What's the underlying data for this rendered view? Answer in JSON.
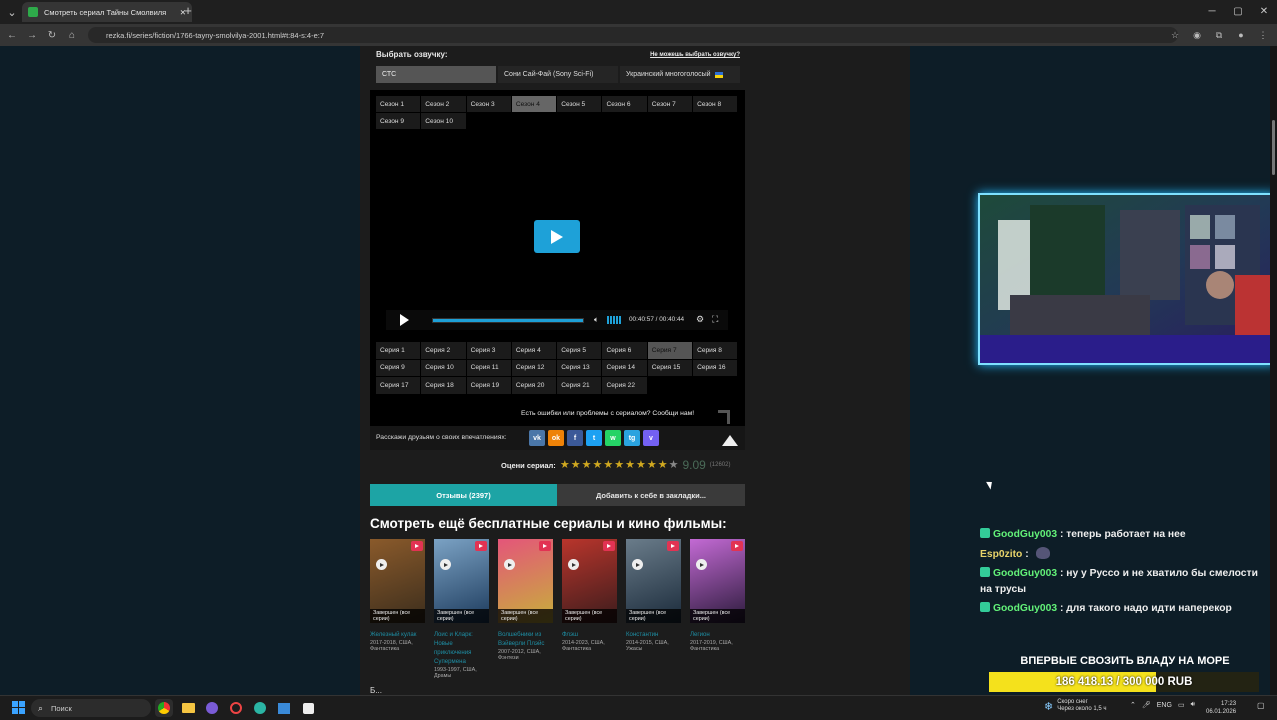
{
  "browser": {
    "tab_title": "Смотреть сериал Тайны Смолвиля",
    "url": "rezka.fi/series/fiction/1766-tayny-smolvilya-2001.html#t:84-s:4-e:7"
  },
  "voice": {
    "label": "Выбрать озвучку:",
    "cant_choose": "Не можешь выбрать озвучку?",
    "options": [
      "СТС",
      "Сони Сай-Фай (Sony Sci-Fi)",
      "Украинский многоголосый"
    ]
  },
  "seasons": [
    "Сезон 1",
    "Сезон 2",
    "Сезон 3",
    "Сезон 4",
    "Сезон 5",
    "Сезон 6",
    "Сезон 7",
    "Сезон 8",
    "Сезон 9",
    "Сезон 10"
  ],
  "active_season": "Сезон 4",
  "player": {
    "current_time": "00:40:57",
    "total_time": "00:40:44",
    "progress": 1.0
  },
  "episodes": [
    "Серия 1",
    "Серия 2",
    "Серия 3",
    "Серия 4",
    "Серия 5",
    "Серия 6",
    "Серия 7",
    "Серия 8",
    "Серия 9",
    "Серия 10",
    "Серия 11",
    "Серия 12",
    "Серия 13",
    "Серия 14",
    "Серия 15",
    "Серия 16",
    "Серия 17",
    "Серия 18",
    "Серия 19",
    "Серия 20",
    "Серия 21",
    "Серия 22"
  ],
  "active_episode": "Серия 7",
  "report_text": "Есть ошибки или проблемы с сериалом? Сообщи нам!",
  "share": {
    "label": "Расскажи друзьям о своих впечатлениях:",
    "networks": [
      {
        "name": "vk",
        "glyph": "vk",
        "color": "#4a76a8"
      },
      {
        "name": "odnoklassniki",
        "glyph": "ok",
        "color": "#ee8208"
      },
      {
        "name": "facebook",
        "glyph": "f",
        "color": "#3b5998"
      },
      {
        "name": "twitter",
        "glyph": "t",
        "color": "#1da1f2"
      },
      {
        "name": "whatsapp",
        "glyph": "w",
        "color": "#25d366"
      },
      {
        "name": "telegram",
        "glyph": "tg",
        "color": "#2aa3df"
      },
      {
        "name": "viber",
        "glyph": "v",
        "color": "#7360f2"
      }
    ]
  },
  "rating": {
    "label": "Оцени сериал:",
    "value": "9.09",
    "count": "(12602)",
    "stars_filled": 10
  },
  "tabs": {
    "reviews": "Отзывы (2397)",
    "bookmark": "Добавить к себе в закладки..."
  },
  "more": {
    "title": "Смотреть ещё бесплатные сериалы и кино фильмы:",
    "cut": "Б...",
    "cards": [
      {
        "title": "Железный кулак",
        "meta": "2017-2018, США, Фантастика",
        "status": "Завершен (все серии)",
        "c1": "#3b2d1c",
        "c2": "#8a5a2b"
      },
      {
        "title": "Лоис и Кларк: Новые приключения Супермена",
        "meta": "1993-1997, США, Драмы",
        "status": "Завершен (все серии)",
        "c1": "#1c3a5c",
        "c2": "#7ba2c4"
      },
      {
        "title": "Волшебники из Вэйверли Плэйс",
        "meta": "2007-2012, США, Фэнтези",
        "status": "Завершен (все серии)",
        "c1": "#c7b03a",
        "c2": "#e4557a"
      },
      {
        "title": "Флэш",
        "meta": "2014-2023, США, Фантастика",
        "status": "Завершен (все серии)",
        "c1": "#3a1c1c",
        "c2": "#b9352c"
      },
      {
        "title": "Константин",
        "meta": "2014-2015, США, Ужасы",
        "status": "Завершен (все серии)",
        "c1": "#1a2a3a",
        "c2": "#6a7c8a"
      },
      {
        "title": "Легион",
        "meta": "2017-2019, США, Фантастика",
        "status": "Завершен (все серии)",
        "c1": "#2a1a3a",
        "c2": "#c36ad4"
      }
    ]
  },
  "chat": [
    {
      "name": "GoodGuy003",
      "text": "теперь работает на нее"
    },
    {
      "name": "Esp0zito",
      "text": ""
    },
    {
      "name": "GoodGuy003",
      "text": "ну у Руссо и не хватило бы смелости на трусы"
    },
    {
      "name": "GoodGuy003",
      "text": "для такого надо идти наперекор"
    }
  ],
  "donation": {
    "title": "ВПЕРВЫЕ СВОЗИТЬ ВЛАДУ НА МОРЕ",
    "amount": "186 418.13 / 300 000 RUB",
    "progress": 0.62
  },
  "taskbar": {
    "search_placeholder": "Поиск",
    "weather_title": "Скоро снег",
    "weather_sub": "Через около 1,5 ч",
    "lang": "ENG",
    "time": "17:23",
    "date": "06.01.2026"
  }
}
